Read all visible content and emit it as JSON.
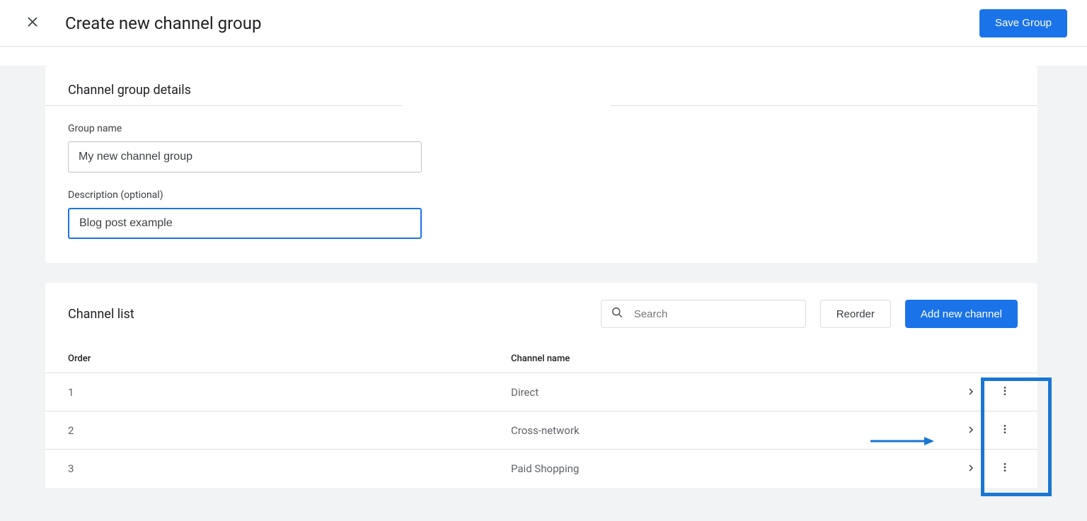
{
  "header": {
    "title": "Create new channel group",
    "save_label": "Save Group"
  },
  "details": {
    "section_title": "Channel group details",
    "group_name_label": "Group name",
    "group_name_value": "My new channel group",
    "description_label": "Description (optional)",
    "description_value": "Blog post example"
  },
  "list": {
    "section_title": "Channel list",
    "search_placeholder": "Search",
    "reorder_label": "Reorder",
    "add_label": "Add new channel",
    "columns": {
      "order": "Order",
      "name": "Channel name"
    },
    "rows": [
      {
        "order": "1",
        "name": "Direct"
      },
      {
        "order": "2",
        "name": "Cross-network"
      },
      {
        "order": "3",
        "name": "Paid Shopping"
      }
    ]
  }
}
